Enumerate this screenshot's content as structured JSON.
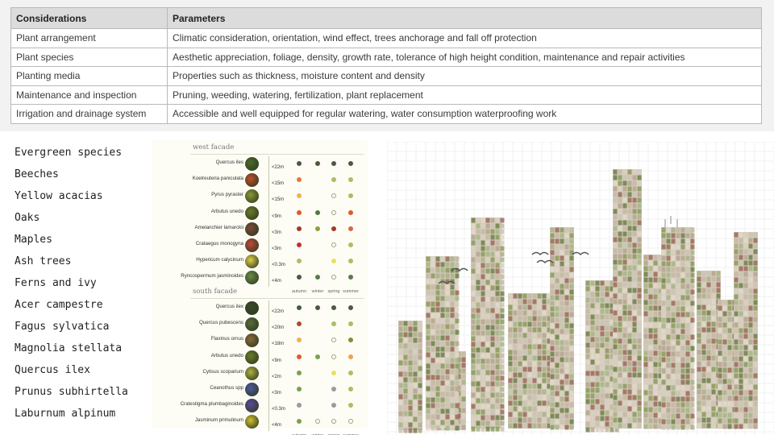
{
  "table": {
    "headers": [
      "Considerations",
      "Parameters"
    ],
    "rows": [
      [
        "Plant arrangement",
        "Climatic consideration, orientation, wind effect, trees anchorage and fall off protection"
      ],
      [
        "Plant species",
        "Aesthetic appreciation, foliage, density, growth rate, tolerance of high height condition, maintenance and repair activities"
      ],
      [
        "Planting media",
        "Properties such as thickness, moisture content and density"
      ],
      [
        "Maintenance and inspection",
        "Pruning, weeding, watering, fertilization, plant replacement"
      ],
      [
        "Irrigation and drainage system",
        "Accessible and well equipped for regular watering, water consumption waterproofing work"
      ]
    ]
  },
  "species_list": [
    "Evergreen species",
    "Beeches",
    "Yellow acacias",
    "Oaks",
    "Maples",
    "Ash trees",
    "Ferns and ivy",
    "Acer campestre",
    "Fagus sylvatica",
    "Magnolia stellata",
    "Quercus ilex",
    "Prunus subhirtella",
    "Laburnum alpinum"
  ],
  "planting_chart": {
    "seasons": [
      "autumn",
      "winter",
      "spring",
      "summer"
    ],
    "facades": [
      {
        "title": "west facade",
        "plants": [
          {
            "name": "Quercus iles",
            "height": "<22m",
            "color": "#4e6a2c",
            "dots": [
              "#4b5a3a",
              "#4b5a3a",
              "#4b5a3a",
              "#4b5a3a"
            ]
          },
          {
            "name": "Koelreuteria paniculata",
            "height": "<15m",
            "color": "#c0502a",
            "dots": [
              "#e07a3a",
              null,
              "#a8c060",
              "#a8c060"
            ]
          },
          {
            "name": "Pyrus pyraster",
            "height": "<15m",
            "color": "#8a9a3a",
            "dots": [
              "#f0b050",
              null,
              "hollow",
              "#a8c060"
            ]
          },
          {
            "name": "Arbutus unedo",
            "height": "<9m",
            "color": "#6a7a2a",
            "dots": [
              "#e05a2a",
              "#4f7a3a",
              "hollow",
              "#e05a2a"
            ]
          },
          {
            "name": "Amelanchier lamarckii",
            "height": "<3m",
            "color": "#7a4a3a",
            "dots": [
              "#a03a2a",
              "#8aa040",
              "#a03a2a",
              "#d06a4a"
            ]
          },
          {
            "name": "Crataegus monogyna",
            "height": "<3m",
            "color": "#c04a3a",
            "dots": [
              "#c03030",
              null,
              "hollow",
              "#a8c060"
            ]
          },
          {
            "name": "Hypericum calycinum",
            "height": "<0.3m",
            "color": "#e0d04a",
            "dots": [
              "#a8c060",
              null,
              "#e8e060",
              "#a8c060"
            ]
          },
          {
            "name": "Ryncospermum jasminoides",
            "height": "<4m",
            "color": "#6a8a4a",
            "dots": [
              "#4b5a3a",
              "#5a7a4a",
              "hollow",
              "#5a7a4a"
            ]
          }
        ]
      },
      {
        "title": "south facade",
        "plants": [
          {
            "name": "Quercus ilex",
            "height": "<22m",
            "color": "#3a4a2a",
            "dots": [
              "#4b5a3a",
              "#4b5a3a",
              "#4b5a3a",
              "#4b5a3a"
            ]
          },
          {
            "name": "Quercus pubescens",
            "height": "<20m",
            "color": "#5a6a3a",
            "dots": [
              "#b04a2a",
              null,
              "#a8c060",
              "#a8c060"
            ]
          },
          {
            "name": "Flaxinus ornus",
            "height": "<18m",
            "color": "#8a6a3a",
            "dots": [
              "#f0b050",
              null,
              "hollow",
              "#8a8a3a"
            ]
          },
          {
            "name": "Arbutus unedo",
            "height": "<9m",
            "color": "#6a7a2a",
            "dots": [
              "#e05a2a",
              "#7aa050",
              "hollow",
              "#f0a050"
            ]
          },
          {
            "name": "Cytisus scoparium",
            "height": "<2m",
            "color": "#b0b040",
            "dots": [
              "#7aa050",
              null,
              "#e8e060",
              "#a8c060"
            ]
          },
          {
            "name": "Ceanothus spp",
            "height": "<3m",
            "color": "#4a5aa0",
            "dots": [
              "#7aa050",
              null,
              "#9a9aa0",
              "#a8c060"
            ]
          },
          {
            "name": "Cratestigma plumbaginoides",
            "height": "<0.3m",
            "color": "#5a4aa0",
            "dots": [
              "#9a9aa0",
              null,
              "#9a9aa0",
              "#a8c060"
            ]
          },
          {
            "name": "Jasminum primulinum",
            "height": "<4m",
            "color": "#d0c030",
            "dots": [
              "#7aa050",
              "hollow",
              "hollow",
              "hollow"
            ]
          }
        ]
      }
    ]
  }
}
